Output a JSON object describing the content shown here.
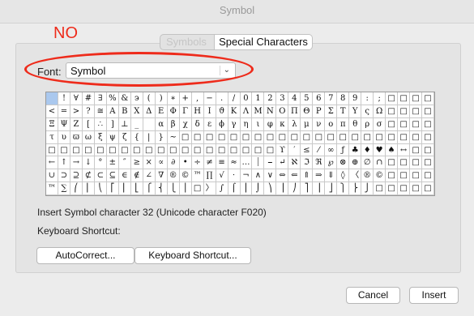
{
  "window": {
    "title": "Symbol"
  },
  "annotation": {
    "text": "NO"
  },
  "tabs": [
    {
      "label": "Symbols",
      "active": false
    },
    {
      "label": "Special Characters",
      "active": true
    }
  ],
  "font": {
    "label": "Font:",
    "value": "Symbol"
  },
  "symbol_grid": {
    "selected_index": 0,
    "rows": [
      [
        " ",
        "!",
        "∀",
        "#",
        "∃",
        "%",
        "&",
        "϶",
        "(",
        ")",
        "∗",
        "+",
        ",",
        "−",
        ".",
        "/",
        "0",
        "1",
        "2",
        "3",
        "4",
        "5",
        "6",
        "7",
        "8",
        "9",
        ":",
        ";"
      ],
      [
        "<",
        "=",
        ">",
        "?",
        "≅",
        "Α",
        "Β",
        "Χ",
        "Δ",
        "Ε",
        "Φ",
        "Γ",
        "Η",
        "Ι",
        "ϑ",
        "Κ",
        "Λ",
        "Μ",
        "Ν",
        "Ο",
        "Π",
        "Θ",
        "Ρ",
        "Σ",
        "Τ",
        "Υ",
        "ς",
        "Ω"
      ],
      [
        "Ξ",
        "Ψ",
        "Ζ",
        "[",
        "∴",
        "]",
        "⊥",
        "_",
        "",
        "α",
        "β",
        "χ",
        "δ",
        "ε",
        "ϕ",
        "γ",
        "η",
        "ι",
        "φ",
        "κ",
        "λ",
        "μ",
        "ν",
        "ο",
        "π",
        "θ",
        "ρ",
        "σ"
      ],
      [
        "τ",
        "υ",
        "ϖ",
        "ω",
        "ξ",
        "ψ",
        "ζ",
        "{",
        "|",
        "}",
        "∼",
        "□",
        "□",
        "□",
        "□",
        "□",
        "□",
        "□",
        "□",
        "□",
        "□",
        "□",
        "□",
        "□",
        "□",
        "□",
        "□",
        "□"
      ],
      [
        "□",
        "□",
        "□",
        "□",
        "□",
        "□",
        "□",
        "□",
        "□",
        "□",
        "□",
        "□",
        "□",
        "□",
        "□",
        "□",
        "□",
        "□",
        "□",
        "ϒ",
        "′",
        "≤",
        "⁄",
        "∞",
        "ƒ",
        "♣",
        "♦",
        "♥",
        "♠",
        "↔"
      ],
      [
        "←",
        "↑",
        "→",
        "↓",
        "°",
        "±",
        "″",
        "≥",
        "×",
        "∝",
        "∂",
        "•",
        "÷",
        "≠",
        "≡",
        "≈",
        "…",
        "⏐",
        "⎯",
        "↵",
        "ℵ",
        "ℑ",
        "ℜ",
        "℘",
        "⊗",
        "⊕",
        "∅",
        "∩"
      ],
      [
        "∪",
        "⊃",
        "⊇",
        "⊄",
        "⊂",
        "⊆",
        "∈",
        "∉",
        "∠",
        "∇",
        "®",
        "©",
        "™",
        "∏",
        "√",
        "⋅",
        "¬",
        "∧",
        "∨",
        "⇔",
        "⇐",
        "⇑",
        "⇒",
        "⇓",
        "◊",
        "〈",
        "®",
        "©"
      ],
      [
        "™",
        "∑",
        "⎛",
        "⎜",
        "⎝",
        "⎡",
        "⎢",
        "⎣",
        "⎧",
        "⎨",
        "⎩",
        "⎪",
        "□",
        "〉",
        "∫",
        "⌠",
        "⎮",
        "⌡",
        "⎞",
        "⎟",
        "⎠",
        "⎤",
        "⎥",
        "⎦",
        "⎫",
        "⎬",
        "⎭",
        "□"
      ]
    ]
  },
  "info": {
    "symbol_text": "Insert Symbol character 32  (Unicode character F020)",
    "shortcut_label": "Keyboard Shortcut:"
  },
  "buttons": {
    "autocorrect": "AutoCorrect...",
    "keyboard_shortcut": "Keyboard Shortcut...",
    "cancel": "Cancel",
    "insert": "Insert"
  },
  "colors": {
    "annotation_red": "#ee2b1b",
    "selection_blue": "#aac8ee"
  }
}
